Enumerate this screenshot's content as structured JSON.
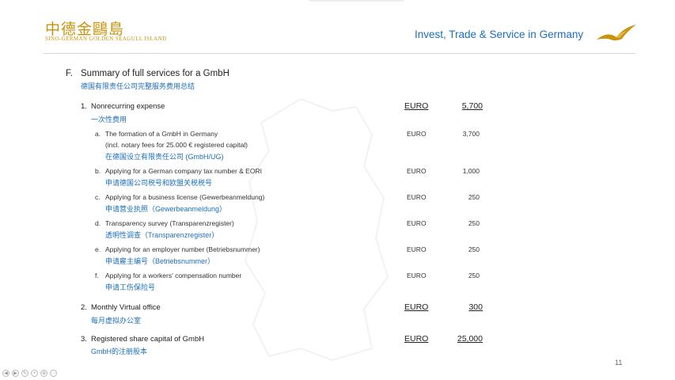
{
  "header": {
    "brand_cn": "中德金鷗島",
    "brand_en": "SINO-GERMAN GOLDEN SEAGULL ISLAND",
    "tagline": "Invest, Trade & Service in Germany"
  },
  "section": {
    "letter": "F.",
    "title": "Summary of full services for a GmbH",
    "title_cn": "德国有限责任公司完整服务费用总结"
  },
  "items": [
    {
      "num": "1.",
      "label": "Nonrecurring expense",
      "label_cn": "一次性费用",
      "currency": "EURO",
      "amount": "5,700",
      "subs": [
        {
          "letter": "a.",
          "label": "The formation of a GmbH in Germany",
          "extra": "(incl. notary fees for 25.000 € registered capital)",
          "label_cn": "在德国设立有限责任公司 (GmbH/UG)",
          "currency": "EURO",
          "amount": "3,700"
        },
        {
          "letter": "b.",
          "label": "Applying for a German company tax number & EORI",
          "label_cn": "申请德国公司税号和欧盟关税税号",
          "currency": "EURO",
          "amount": "1,000"
        },
        {
          "letter": "c.",
          "label": "Applying for a business license (Gewerbeanmeldung)",
          "label_cn": "申请营业执照（Gewerbeanmeldung）",
          "currency": "EURO",
          "amount": "250"
        },
        {
          "letter": "d.",
          "label": "Transparency survey (Transparenzregister)",
          "label_cn": "透明性调查（Transparenzregister）",
          "currency": "EURO",
          "amount": "250"
        },
        {
          "letter": "e.",
          "label": "Applying for an employer number (Betriebsnummer)",
          "label_cn": "申请雇主编号（Betriebsnummer）",
          "currency": "EURO",
          "amount": "250"
        },
        {
          "letter": "f.",
          "label": "Applying for a workers' compensation number",
          "label_cn": "申请工伤保险号",
          "currency": "EURO",
          "amount": "250"
        }
      ]
    },
    {
      "num": "2.",
      "label": "Monthly Virtual office",
      "label_cn": "每月虚拟办公室",
      "currency": "EURO",
      "amount": "300"
    },
    {
      "num": "3.",
      "label": "Registered share capital of GmbH",
      "label_cn": "GmbH的注册股本",
      "currency": "EURO",
      "amount": "25,000"
    }
  ],
  "page_number": "11",
  "colors": {
    "brand_gold": "#c9930b",
    "accent_blue": "#1d6fb8"
  },
  "toolbar_icons": [
    "prev-icon",
    "next-icon",
    "pen-icon",
    "pointer-icon",
    "zoom-icon",
    "menu-icon"
  ]
}
